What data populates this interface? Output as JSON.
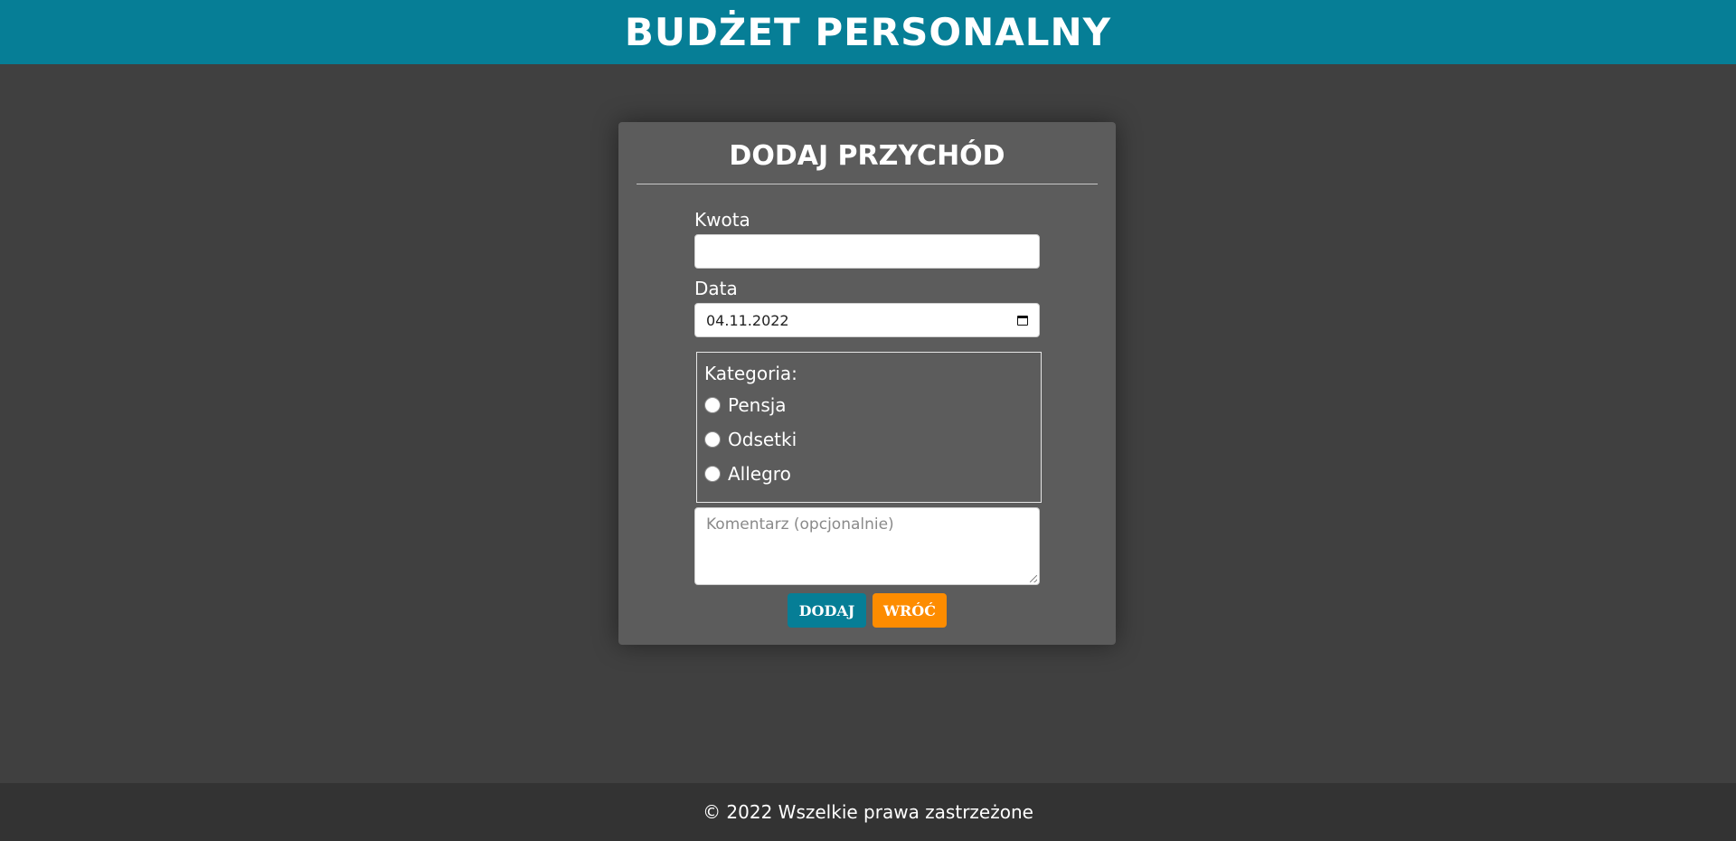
{
  "header": {
    "title": "BUDŻET PERSONALNY"
  },
  "form": {
    "title": "DODAJ PRZYCHÓD",
    "amount": {
      "label": "Kwota",
      "value": ""
    },
    "date": {
      "label": "Data",
      "value": "04.11.2022",
      "icon": "calendar-icon"
    },
    "category": {
      "legend": "Kategoria:",
      "options": [
        "Pensja",
        "Odsetki",
        "Allegro"
      ],
      "selected": null
    },
    "comment": {
      "placeholder": "Komentarz (opcjonalnie)",
      "value": ""
    },
    "buttons": {
      "add_label": "DODAJ",
      "back_label": "WRÓĆ"
    }
  },
  "footer": {
    "text": "© 2022 Wszelkie prawa zastrzeżone"
  },
  "colors": {
    "brand": "#067e96",
    "accent": "#fd8c00",
    "background": "#404040",
    "card": "#5c5c5c",
    "footer": "#333333"
  }
}
